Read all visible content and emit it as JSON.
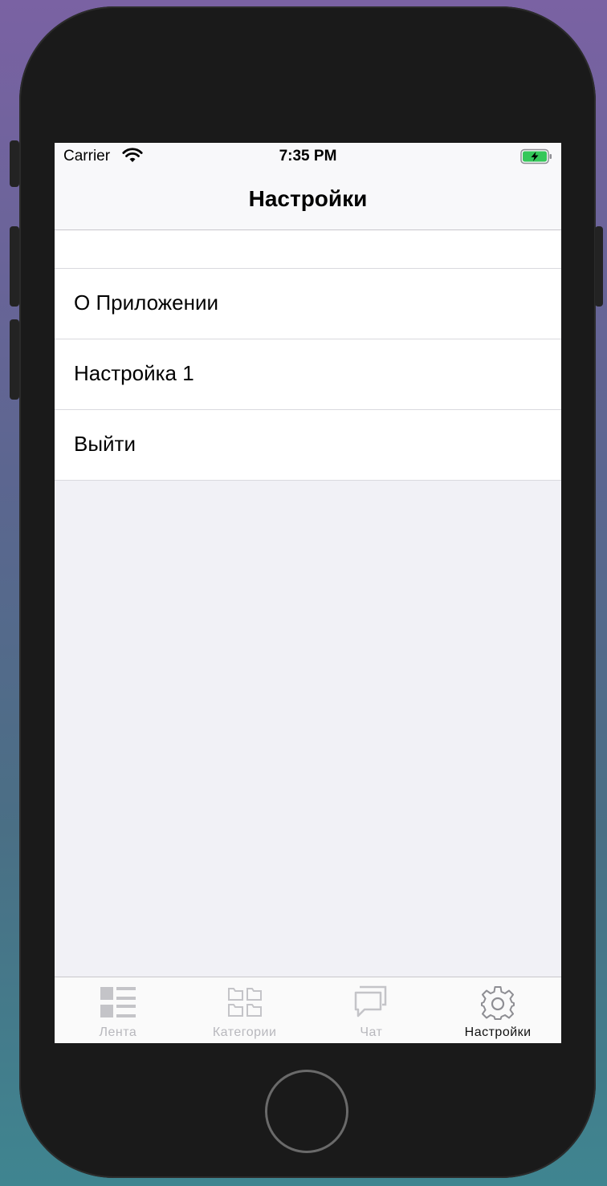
{
  "status_bar": {
    "carrier": "Carrier",
    "time": "7:35 PM",
    "wifi_icon": "wifi-icon",
    "battery_icon": "battery-charging-icon",
    "battery_color": "#34c759"
  },
  "nav": {
    "title": "Настройки"
  },
  "settings_list": {
    "items": [
      {
        "label": "О Приложении"
      },
      {
        "label": "Настройка 1"
      },
      {
        "label": "Выйти"
      }
    ]
  },
  "tab_bar": {
    "active_index": 3,
    "tabs": [
      {
        "label": "Лента",
        "icon": "feed-icon"
      },
      {
        "label": "Категории",
        "icon": "categories-icon"
      },
      {
        "label": "Чат",
        "icon": "chat-icon"
      },
      {
        "label": "Настройки",
        "icon": "gear-icon"
      }
    ]
  },
  "colors": {
    "inactive_tab": "#b8b8bd",
    "active_tab": "#111111",
    "background": "#f1f1f6"
  }
}
